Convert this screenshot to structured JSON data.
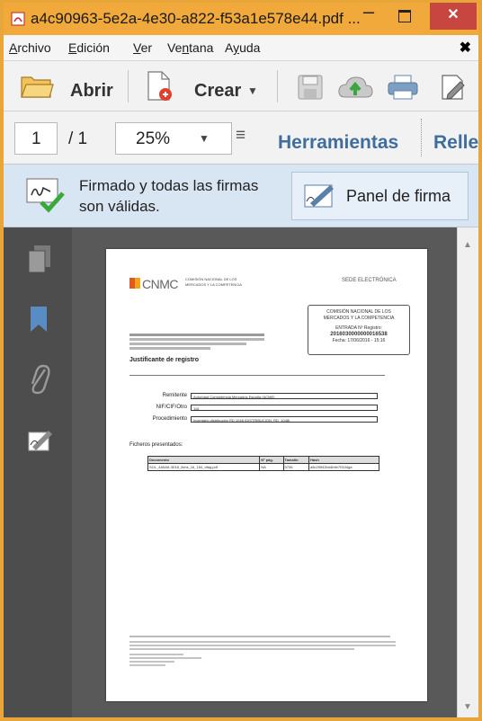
{
  "window": {
    "title": "a4c90963-5e2a-4e30-a822-f53a1e578e44.pdf ...",
    "min_glyph": "–",
    "close_glyph": "✕"
  },
  "menu": {
    "items": [
      {
        "label": "Archivo",
        "accel": "A"
      },
      {
        "label": "Edición",
        "accel": "E"
      },
      {
        "label": "Ver",
        "accel": "V"
      },
      {
        "label": "Ventana",
        "accel": "n"
      },
      {
        "label": "Ayuda",
        "accel": "y"
      }
    ],
    "close_glyph": "✖"
  },
  "toolbar": {
    "open_label": "Abrir",
    "create_label": "Crear",
    "create_arrow": "▼"
  },
  "nav": {
    "page_current": "1",
    "page_total": "/ 1",
    "zoom": "25%",
    "zoom_arrow": "▼",
    "fit_glyph": "≡",
    "tools_label": "Herramientas",
    "fill_label": "Relle"
  },
  "signature": {
    "status_text": "Firmado y todas las firmas son válidas.",
    "panel_button": "Panel de firma"
  },
  "scroll": {
    "up": "▲",
    "down": "▼"
  },
  "document": {
    "org_line1": "COMISIÓN NACIONAL DE LOS",
    "org_line2": "MERCADOS Y LA COMPETENCIA",
    "sede": "SEDE ELECTRÓNICA",
    "stamp": {
      "line1": "COMISIÓN NACIONAL DE LOS",
      "line2": "MERCADOS Y LA COMPETENCIA",
      "line3": "ENTRADA Nº Registro:",
      "number": "2016030000000016538",
      "date": "Fecha: 17/06/2016 - 15:16"
    },
    "title": "Justificante de registro",
    "fields": [
      {
        "label": "Remitente",
        "value": "Autoridad Competencia Mercados España (ACME)"
      },
      {
        "label": "NIF/CIF/Otro",
        "value": "116"
      },
      {
        "label": "Procedimiento",
        "value": "Inventario distribución RD 1048 (DISTRIBUCION_RD_1048)"
      }
    ],
    "files_title": "Ficheros presentados:",
    "table": {
      "headers": [
        "Documento",
        "Nº pág.",
        "Tamaño",
        "Hash"
      ],
      "rows": [
        [
          "SOL_4A5A5-3D16_fichs_16_154_dfag.pdf",
          "NA",
          "5706",
          "a5c2f0f42bd4b9e7f31f4ga"
        ]
      ]
    }
  }
}
